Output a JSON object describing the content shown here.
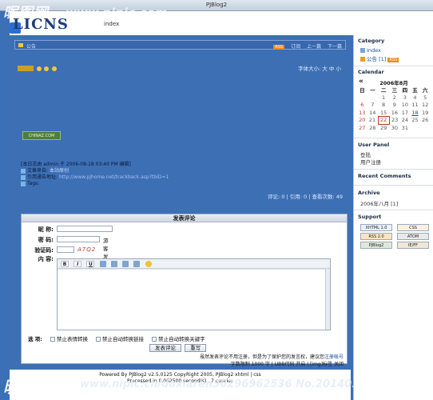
{
  "browser": {
    "title": "PJBlog2"
  },
  "watermark": {
    "top_brand": "昵图网",
    "top_url": "www.nipic.com",
    "bottom_brand": "昵享网",
    "bottom_url": "www.nipic.cn/daxiaren36296962536 No.2014010184510812063"
  },
  "header": {
    "logo": "LICNS",
    "nav_text": "index"
  },
  "crumb": {
    "text": "公告",
    "rss": "RSS",
    "prev": "上一篇",
    "next": "下一篇",
    "tag_label": "订阅"
  },
  "post": {
    "title": "",
    "font_size_label": "字体大小: 大 中 小",
    "author_line": "[本日志由 admin 于 2006-08-18 03:40 PM 编辑]",
    "source_label": "文章来自:",
    "source_value": "本站原创",
    "trackback_label": "引用通告地址:",
    "trackback_value": "http://www.pjhome.net/trackback.asp?tbID=1",
    "tags_label": "Tags:",
    "stats": "评论: 0 | 引用: 0 | 查看次数: 49",
    "image_label": "CHINAZ.COM"
  },
  "form": {
    "title": "发表评论",
    "nickname_label": "昵 称:",
    "password_label": "密 码:",
    "password_hint": "游客发言不需要密码.",
    "captcha_label": "验证码:",
    "captcha_value": "A7Q2",
    "content_label": "内 容:",
    "options_label": "选 项:",
    "opt1": "禁止表情转换",
    "opt2": "禁止自动转换链接",
    "opt3": "禁止自动转换关键字",
    "submit": "发表评论",
    "reset": "重写",
    "note": "虽然发表评论不用注册，但是为了保护您的发言权，建议您",
    "note_link": "注册帐号",
    "limit": "字数限制 1000 字 | UBB代码 开启 | [img]标签 关闭"
  },
  "footer": {
    "line1": "Powered By PJBlog2 v2.5.0125 CopyRight 2005, PJBlog2 xhtml | css",
    "line2": "Processed in 0.062500 second(s) , 7 queries"
  },
  "sidebar": {
    "category_title": "Category",
    "cat_index": "Index",
    "cat_notice": "公告 [1]",
    "calendar_title": "Calendar",
    "cal_month": "2006年8月",
    "cal_prev": "«",
    "weekdays": [
      "日",
      "一",
      "二",
      "三",
      "四",
      "五",
      "六"
    ],
    "weeks": [
      [
        "",
        "",
        "1",
        "2",
        "3",
        "4",
        "5"
      ],
      [
        "6",
        "7",
        "8",
        "9",
        "10",
        "11",
        "12"
      ],
      [
        "13",
        "14",
        "15",
        "16",
        "17",
        "18",
        "19"
      ],
      [
        "20",
        "21",
        "22",
        "23",
        "24",
        "25",
        "26"
      ],
      [
        "27",
        "28",
        "29",
        "30",
        "31",
        "",
        ""
      ]
    ],
    "userpanel_title": "User Panel",
    "login": "登陆",
    "register": "用户注册",
    "recent_title": "Recent Comments",
    "archive_title": "Archive",
    "archive_item": "2006年八月 [1]",
    "support_title": "Support",
    "badges": [
      "XHTML 1.0",
      "CSS",
      "RSS 2.0",
      "ATOM",
      "PJBlog2",
      "IE/FF"
    ]
  }
}
